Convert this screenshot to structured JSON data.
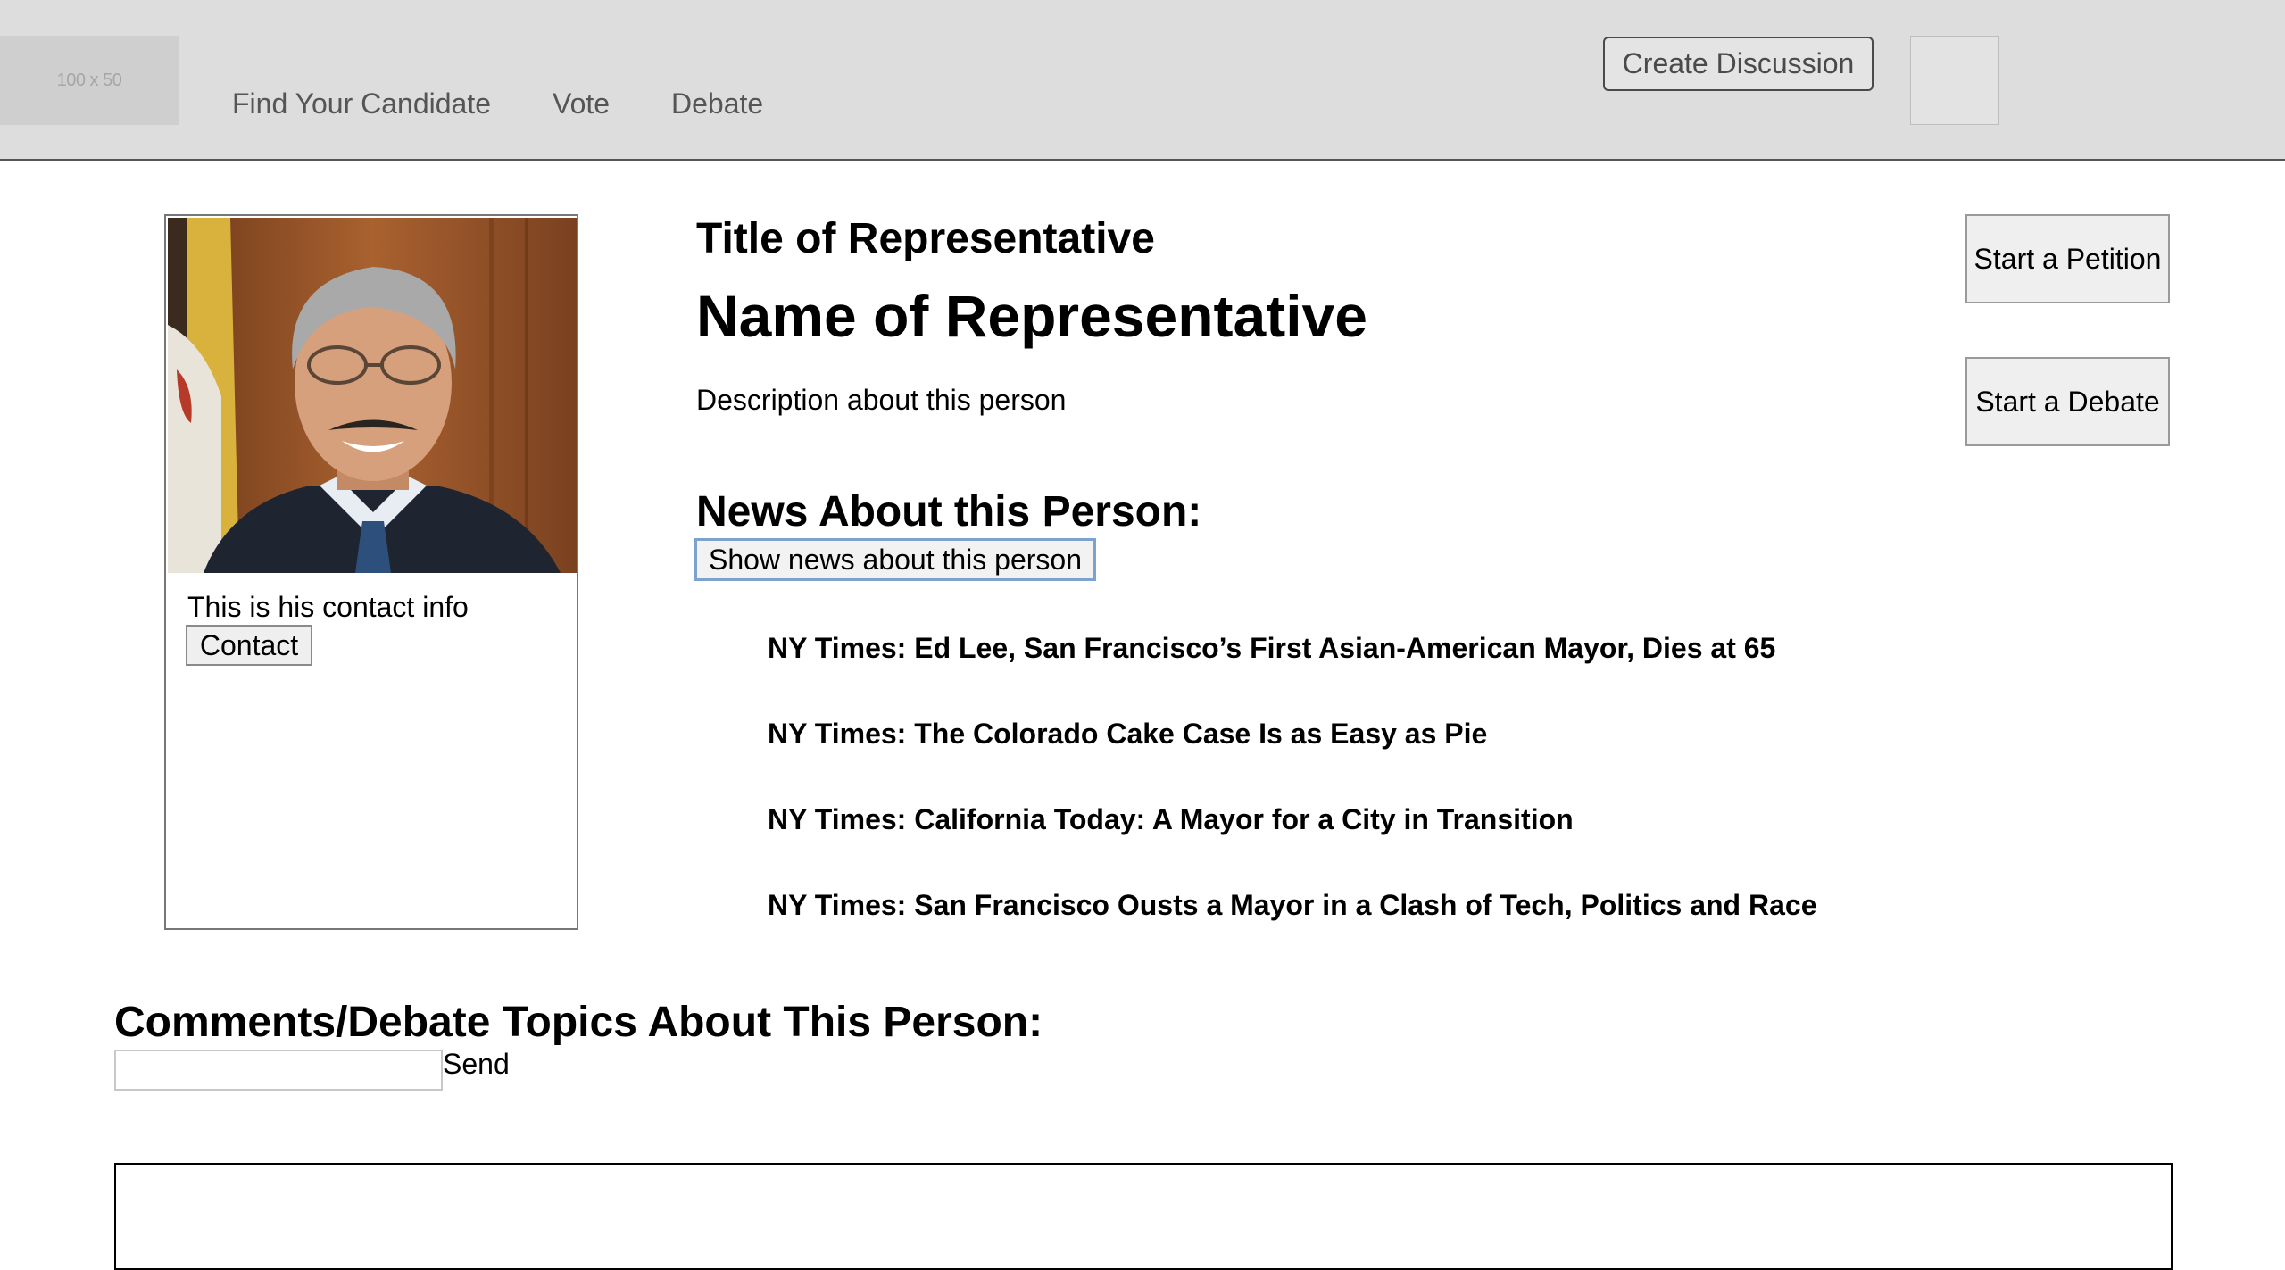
{
  "header": {
    "logo_placeholder": "100 x 50",
    "nav": [
      "Find Your Candidate",
      "Vote",
      "Debate"
    ],
    "create_discussion": "Create Discussion"
  },
  "profile": {
    "contact_info": "This is his contact info",
    "contact_button": "Contact",
    "title": "Title of Representative",
    "name": "Name of Representative",
    "description": "Description about this person"
  },
  "actions": {
    "start_petition": "Start a Petition",
    "start_debate": "Start a Debate"
  },
  "news": {
    "heading": "News About this Person:",
    "show_button": "Show news about this person",
    "items": [
      "NY Times: Ed Lee, San Francisco’s First Asian-American Mayor, Dies at 65",
      "NY Times: The Colorado Cake Case Is as Easy as Pie",
      "NY Times: California Today: A Mayor for a City in Transition",
      "NY Times: San Francisco Ousts a Mayor in a Clash of Tech, Politics and Race"
    ]
  },
  "comments": {
    "heading": "Comments/Debate Topics About This Person:",
    "input_value": "",
    "send_label": "Send"
  }
}
